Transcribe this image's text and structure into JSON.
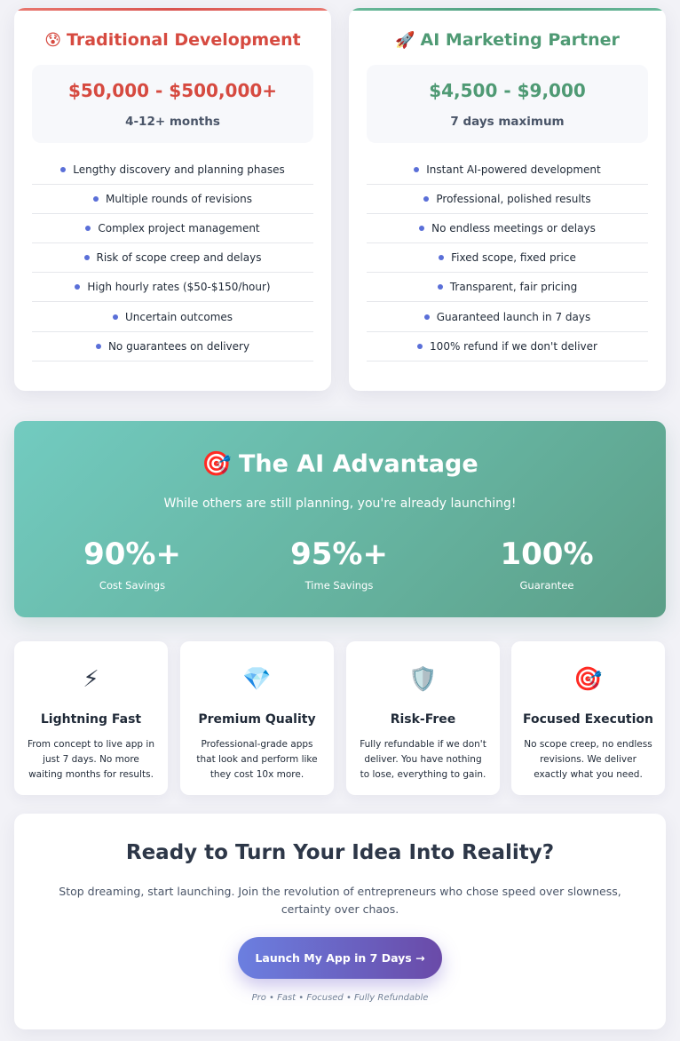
{
  "comparison": {
    "traditional": {
      "emoji": "😰",
      "title": "Traditional Development",
      "price": "$50,000 - $500,000+",
      "duration": "4-12+ months",
      "features": [
        "Lengthy discovery and planning phases",
        "Multiple rounds of revisions",
        "Complex project management",
        "Risk of scope creep and delays",
        "High hourly rates ($50-$150/hour)",
        "Uncertain outcomes",
        "No guarantees on delivery"
      ]
    },
    "ai": {
      "emoji": "🚀",
      "title": "AI Marketing Partner",
      "price": "$4,500 - $9,000",
      "duration": "7 days maximum",
      "features": [
        "Instant AI-powered development",
        "Professional, polished results",
        "No endless meetings or delays",
        "Fixed scope, fixed price",
        "Transparent, fair pricing",
        "Guaranteed launch in 7 days",
        "100% refund if we don't deliver"
      ]
    }
  },
  "advantage": {
    "emoji": "🎯",
    "title": "The AI Advantage",
    "subtitle": "While others are still planning, you're already launching!",
    "stats": [
      {
        "value": "90%+",
        "label": "Cost Savings"
      },
      {
        "value": "95%+",
        "label": "Time Savings"
      },
      {
        "value": "100%",
        "label": "Guarantee"
      }
    ]
  },
  "benefits": [
    {
      "icon": "⚡",
      "title": "Lightning Fast",
      "description": "From concept to live app in just 7 days. No more waiting months for results."
    },
    {
      "icon": "💎",
      "title": "Premium Quality",
      "description": "Professional-grade apps that look and perform like they cost 10x more."
    },
    {
      "icon": "🛡️",
      "title": "Risk-Free",
      "description": "Fully refundable if we don't deliver. You have nothing to lose, everything to gain."
    },
    {
      "icon": "🎯",
      "title": "Focused Execution",
      "description": "No scope creep, no endless revisions. We deliver exactly what you need."
    }
  ],
  "cta": {
    "title": "Ready to Turn Your Idea Into Reality?",
    "text": "Stop dreaming, start launching. Join the revolution of entrepreneurs who chose speed over slowness, certainty over chaos.",
    "button_label": "Launch My App in 7 Days →",
    "footnote": "Pro • Fast • Focused • Fully Refundable"
  },
  "colors": {
    "traditional_accent": "#d64a40",
    "ai_accent": "#4f9a74",
    "banner_teal": "#66b4a1",
    "button_gradient_start": "#6b7fe0",
    "button_gradient_end": "#6a4aa8"
  }
}
